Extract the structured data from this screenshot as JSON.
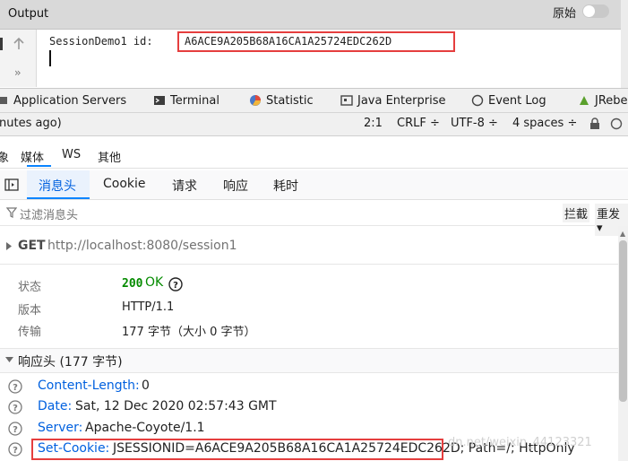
{
  "ide": {
    "output_title": "Output",
    "console_prefix": "SessionDemo1 id: ",
    "session_id": "A6ACE9A205B68A16CA1A25724EDC262D",
    "more_glyph": "››",
    "tool_tabs": [
      "Application Servers",
      "Terminal",
      "Statistic",
      "Java Enterprise",
      "Event Log",
      "JRebe"
    ],
    "status": {
      "left": "nutes ago)",
      "position": "2:1",
      "line_ending": "CRLF ÷",
      "encoding": "UTF-8 ÷",
      "indent": "4 spaces ÷",
      "lock_icon": "lock-icon",
      "ext_icon": "ext-icon"
    }
  },
  "devtools": {
    "tabs": [
      "象",
      "媒体",
      "WS",
      "其他"
    ],
    "sub_tabs": [
      "消息头",
      "Cookie",
      "请求",
      "响应",
      "耗时"
    ],
    "active_sub_tab": "消息头",
    "filter_placeholder": "过滤消息头",
    "block_label": "拦截",
    "resend_label": "重发 ▾",
    "request": {
      "method": "GET",
      "url": "http://localhost:8080/session1"
    },
    "summary": {
      "status_label": "状态",
      "status_code": "200",
      "status_text": "OK",
      "version_label": "版本",
      "version_value": "HTTP/1.1",
      "transfer_label": "传输",
      "transfer_value": "177 字节（大小 0 字节）"
    },
    "response_headers_title": "响应头 (177 字节)",
    "raw_label": "原始",
    "raw_enabled": false,
    "headers": [
      {
        "name": "Content-Length:",
        "value": "0"
      },
      {
        "name": "Date:",
        "value": "Sat, 12 Dec 2020 02:57:43 GMT"
      },
      {
        "name": "Server:",
        "value": "Apache-Coyote/1.1"
      },
      {
        "name": "Set-Cookie:",
        "value": "JSESSIONID=A6ACE9A205B68A16CA1A25724EDC262D; Path=/; HttpOnly"
      }
    ]
  },
  "watermark": "dn.net/weixin_44123321",
  "colors": {
    "highlight": "#e53e3e",
    "link": "#0060df",
    "ok": "#058b00",
    "accent": "#0a84ff"
  }
}
